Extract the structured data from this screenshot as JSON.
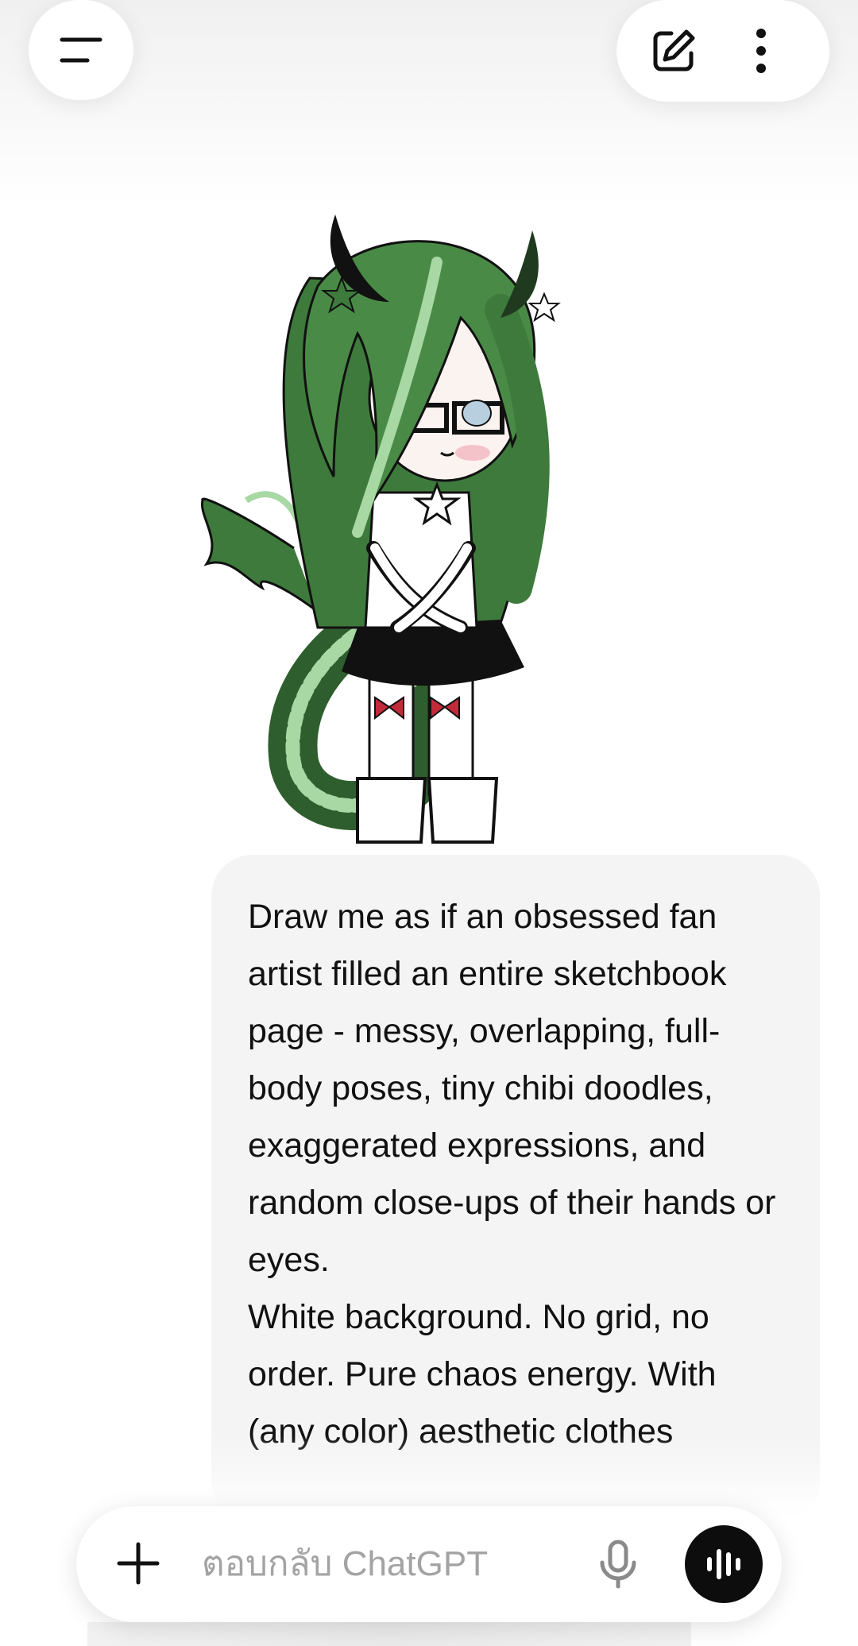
{
  "header": {
    "menu_icon": "menu-lines-icon",
    "new_chat_icon": "pencil-square-icon",
    "more_icon": "vertical-dots-icon"
  },
  "conversation": {
    "image_description_icon": "gacha-character-image",
    "user_message": "Draw me as if an obsessed fan artist filled an entire sketchbook page - messy, overlapping, full-body poses, tiny chibi doodles, exaggerated expressions, and random close-ups of their hands or eyes.\nWhite background. No grid, no order. Pure chaos energy. With (any color) aesthetic clothes"
  },
  "composer": {
    "placeholder": "ตอบกลับ ChatGPT",
    "value": "",
    "plus_icon": "plus-icon",
    "mic_icon": "microphone-icon",
    "voice_icon": "voice-waveform-icon"
  },
  "colors": {
    "bubble": "#f4f4f4",
    "hair_green": "#3e7a3c",
    "accent_dark": "#0d0d0d"
  }
}
